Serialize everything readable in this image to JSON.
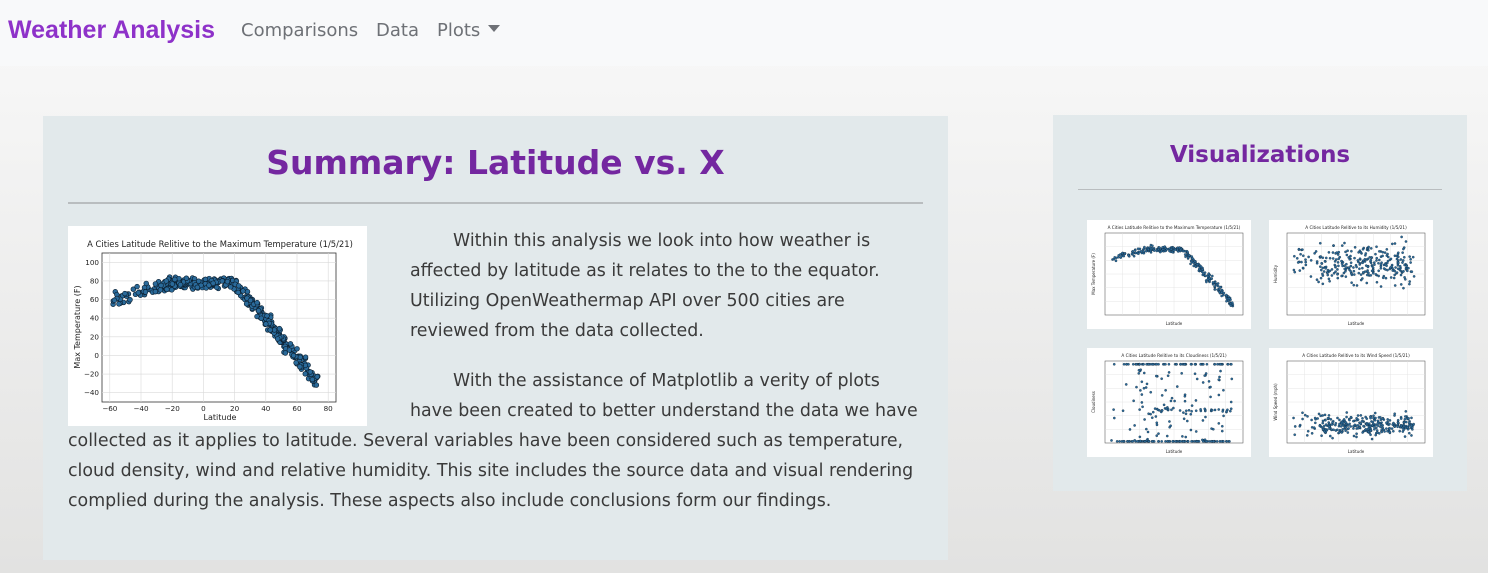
{
  "navbar": {
    "brand": "Weather Analysis",
    "links": [
      "Comparisons",
      "Data",
      "Plots"
    ]
  },
  "summary": {
    "title": "Summary: Latitude vs. X",
    "paragraph1": "Within this analysis we look into how weather is affected by latitude as it relates to the to the equator. Utilizing OpenWeathermap API over 500 cities are reviewed from the data collected.",
    "paragraph2": "With the assistance of Matplotlib a verity of plots have been created to better understand the data we have collected as it applies to latitude. Several variables have been considered such as temperature, cloud density, wind and relative humidity. This site includes the source data and visual rendering complied during the analysis. These aspects also include conclusions form our findings."
  },
  "main_plot": {
    "title": "A Cities Latitude Relitive to the Maximum Temperature (1/5/21)",
    "xlabel": "Latitude",
    "ylabel": "Max Temperature (F)",
    "xticks": [
      "−60",
      "−40",
      "−20",
      "0",
      "20",
      "40",
      "60",
      "80"
    ],
    "yticks": [
      "100",
      "80",
      "60",
      "40",
      "20",
      "0",
      "−20",
      "−40"
    ]
  },
  "visualizations": {
    "title": "Visualizations",
    "thumbnails": [
      {
        "title": "A Cities Latitude Relitive to the Maximum Temperature (1/5/21)",
        "ylabel": "Max Temperature (F)",
        "xlabel": "Latitude"
      },
      {
        "title": "A Cities Latitude Relitive to its Humidity (1/5/21)",
        "ylabel": "Humidity",
        "xlabel": "Latitude"
      },
      {
        "title": "A Cities Latitude Relitive to its Cloudiness (1/5/21)",
        "ylabel": "Cloudiness",
        "xlabel": "Latitude"
      },
      {
        "title": "A Cities Latitude Relitive to its Wind Speed (1/5/21)",
        "ylabel": "Wind Speed (mph)",
        "xlabel": "Latitude"
      }
    ]
  },
  "colors": {
    "brand": "#8e32c9",
    "heading": "#7427a0",
    "panel": "#e2e9eb",
    "marker": "#2a6a9a"
  }
}
